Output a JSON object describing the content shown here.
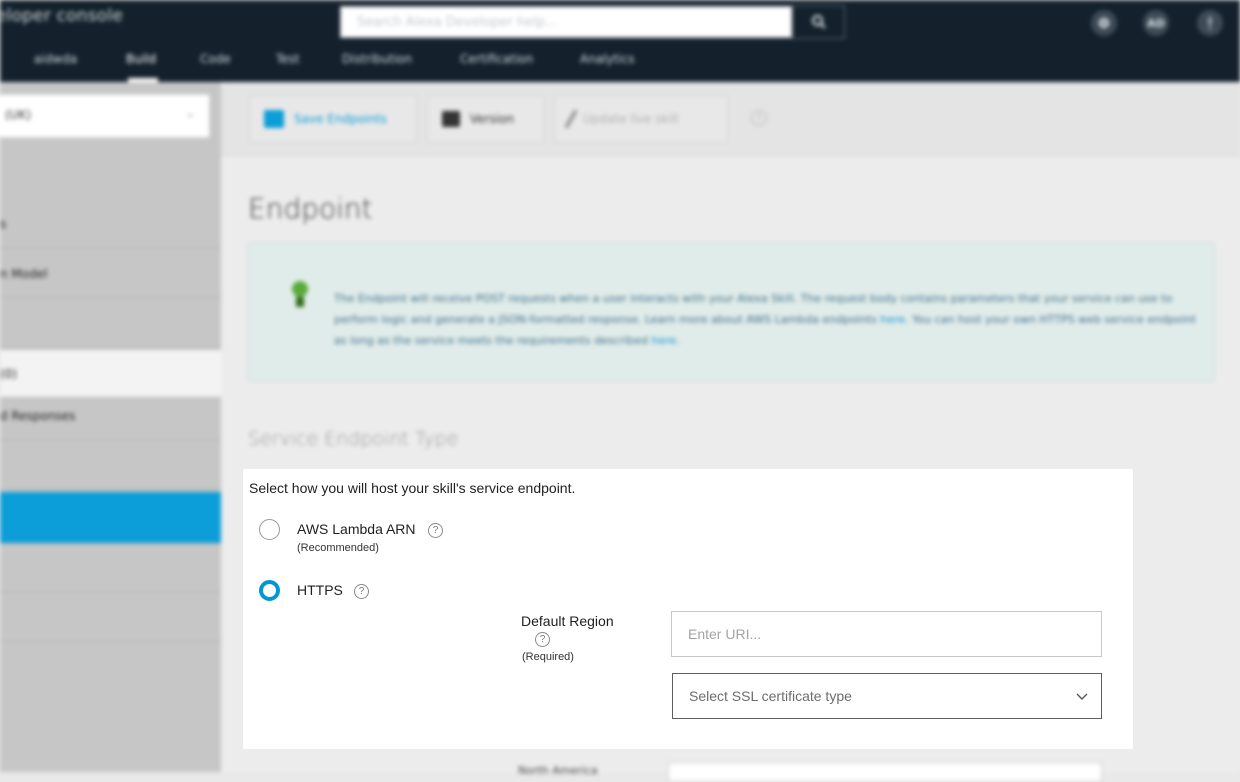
{
  "header": {
    "brand": "eloper console",
    "search_placeholder": "Search Alexa Developer help...",
    "user_initials": "AD",
    "tabs": [
      {
        "label": "aidwda"
      },
      {
        "label": "Build"
      },
      {
        "label": "Code"
      },
      {
        "label": "Test"
      },
      {
        "label": "Distribution"
      },
      {
        "label": "Certification"
      },
      {
        "label": "Analytics"
      }
    ]
  },
  "sidebar": {
    "locale": "(UK)",
    "items": [
      {
        "label": "s"
      },
      {
        "label": "n Model"
      },
      {
        "label": ""
      },
      {
        "label": "(0)"
      },
      {
        "label": "d Responses"
      },
      {
        "label": ""
      },
      {
        "label": ""
      },
      {
        "label": ""
      },
      {
        "label": ""
      }
    ]
  },
  "toolbar": {
    "save_label": "Save Endpoints",
    "version_label": "Version",
    "update_label": "Update live skill",
    "help_glyph": "?"
  },
  "main": {
    "title": "Endpoint",
    "info": {
      "text_1": "The Endpoint will receive POST requests when a user interacts with your Alexa Skill. The request body contains parameters that your service can use to perform logic and generate a JSON-formatted response. Learn more about AWS Lambda endpoints ",
      "link_1": "here",
      "text_2": ". You can host your own HTTPS web service endpoint as long as the service meets the requirements described ",
      "link_2": "here",
      "text_3": "."
    },
    "section_title": "Service Endpoint Type"
  },
  "panel": {
    "intro": "Select how you will host your skill's service endpoint.",
    "options": [
      {
        "label": "AWS Lambda ARN",
        "sub": "(Recommended)",
        "selected": false
      },
      {
        "label": "HTTPS",
        "selected": true
      }
    ],
    "help_glyph": "?",
    "region": {
      "label": "Default Region",
      "sub": "(Required)",
      "uri_placeholder": "Enter URI...",
      "ssl_placeholder": "Select SSL certificate type"
    }
  },
  "footer_field_label": "North America",
  "colors": {
    "accent": "#0097d6",
    "topbar": "#14212c",
    "sidebar_active": "#0b9ed9"
  }
}
